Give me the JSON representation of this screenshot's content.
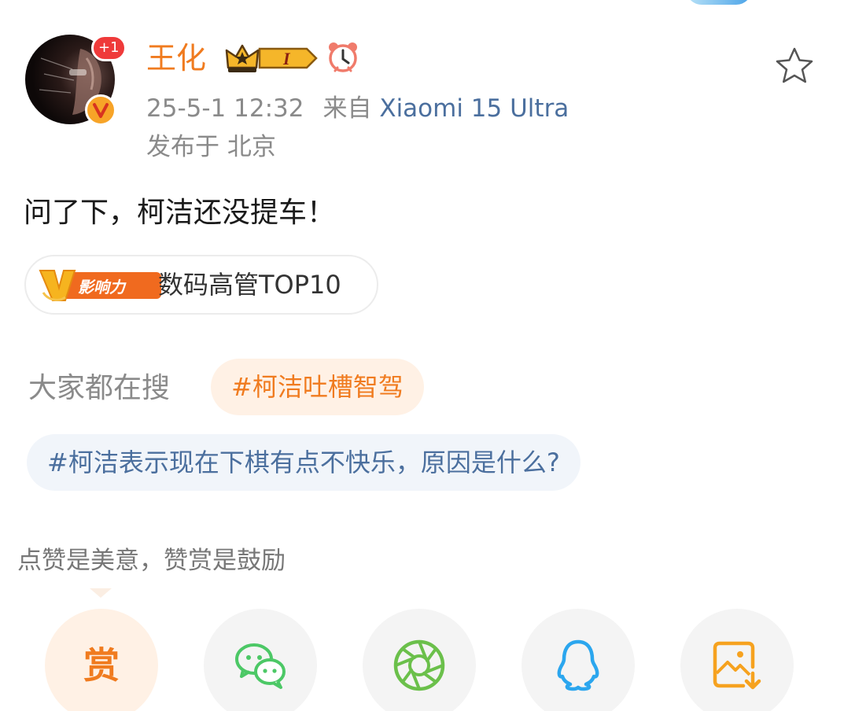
{
  "author": {
    "name": "王化",
    "avatar_badge_count": "+1",
    "verified_icon": "orange-v-verified-icon",
    "member_badge_icon": "crown-level-badge-icon",
    "member_badge_text": "I",
    "clock_icon": "alarm-clock-icon"
  },
  "post_meta": {
    "time": "25-5-1 12:32",
    "from_label": "来自",
    "source": "Xiaomi 15 Ultra",
    "location": "发布于 北京"
  },
  "post": {
    "text": "问了下，柯洁还没提车！",
    "favorite_icon": "star-outline-icon"
  },
  "influence": {
    "badge_label": "影响力",
    "badge_icon": "v-influence-badge-icon",
    "rank_text": "数码高管TOP10"
  },
  "hot_search": {
    "label": "大家都在搜",
    "chip": "#柯洁吐槽智驾",
    "topic": "#柯洁表示现在下棋有点不快乐，原因是什么?"
  },
  "reward": {
    "note": "点赞是美意，赞赏是鼓励",
    "button_char": "赏"
  },
  "share_buttons": [
    {
      "name": "wechat-icon"
    },
    {
      "name": "moments-icon"
    },
    {
      "name": "qq-icon"
    },
    {
      "name": "save-image-icon"
    }
  ],
  "colors": {
    "accent_orange": "#f07b1f",
    "link_blue": "#4b6f9e",
    "wechat_green": "#4cc866",
    "moments_green": "#6bc04b",
    "qq_blue": "#2ba6ee",
    "save_orange": "#f6a21f"
  }
}
